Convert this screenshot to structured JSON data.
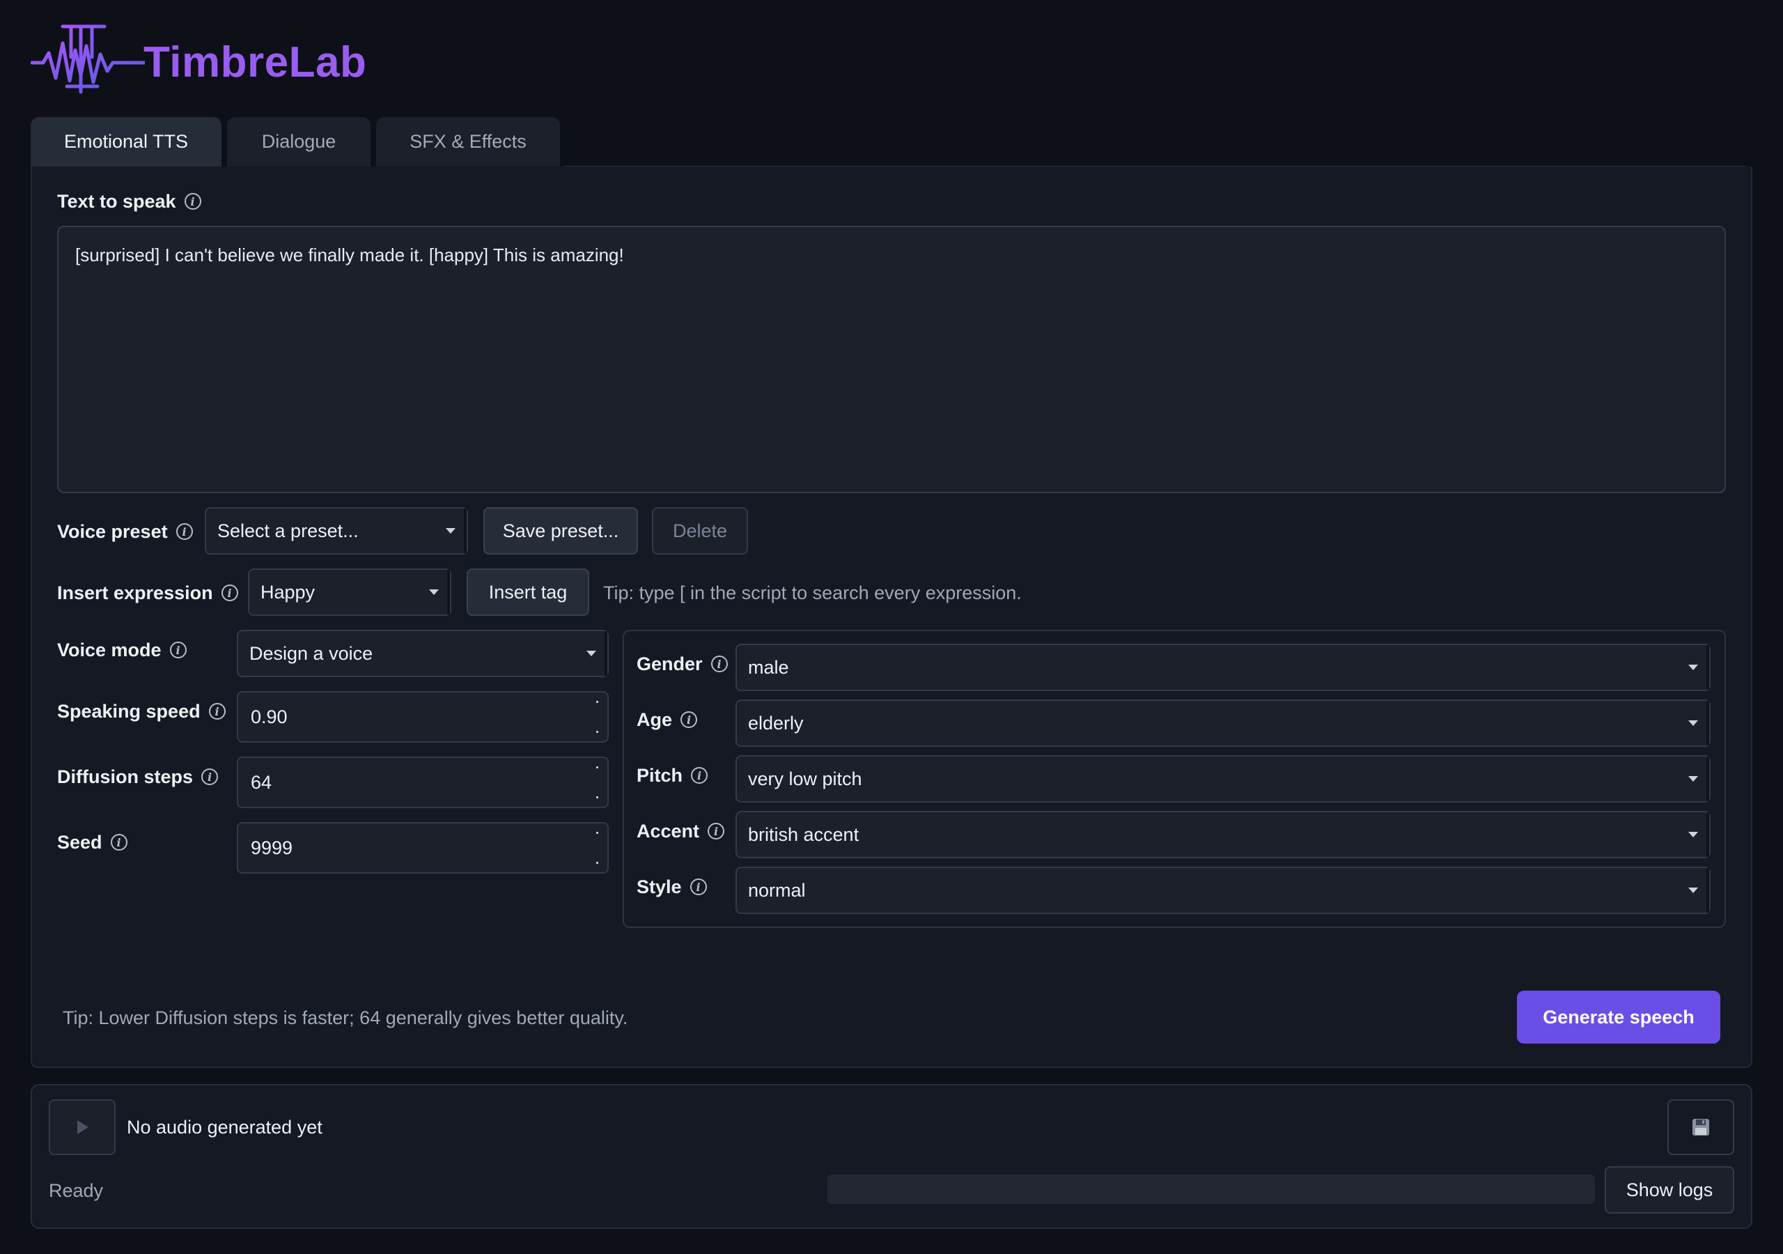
{
  "app": {
    "name": "TimbreLab"
  },
  "tabs": [
    {
      "label": "Emotional TTS",
      "active": true
    },
    {
      "label": "Dialogue",
      "active": false
    },
    {
      "label": "SFX & Effects",
      "active": false
    }
  ],
  "script": {
    "label": "Text to speak",
    "value": "[surprised] I can't believe we finally made it. [happy] This is amazing!"
  },
  "preset": {
    "label": "Voice preset",
    "selected": "Select a preset...",
    "save_label": "Save preset...",
    "delete_label": "Delete"
  },
  "expression": {
    "label": "Insert expression",
    "selected": "Happy",
    "insert_label": "Insert tag",
    "tip": "Tip: type [ in the script to search every expression."
  },
  "voice_mode": {
    "label": "Voice mode",
    "selected": "Design a voice"
  },
  "speed": {
    "label": "Speaking speed",
    "value": "0.90"
  },
  "steps": {
    "label": "Diffusion steps",
    "value": "64"
  },
  "seed": {
    "label": "Seed",
    "value": "9999"
  },
  "design": {
    "gender": {
      "label": "Gender",
      "selected": "male"
    },
    "age": {
      "label": "Age",
      "selected": "elderly"
    },
    "pitch": {
      "label": "Pitch",
      "selected": "very low pitch"
    },
    "accent": {
      "label": "Accent",
      "selected": "british accent"
    },
    "style": {
      "label": "Style",
      "selected": "normal"
    }
  },
  "footer": {
    "tip": "Tip: Lower Diffusion steps is faster; 64 generally gives better quality.",
    "generate_label": "Generate speech"
  },
  "player": {
    "empty_text": "No audio generated yet",
    "status": "Ready",
    "progress": 0,
    "logs_label": "Show logs"
  },
  "colors": {
    "accent": "#6a4ee6",
    "logo": "#9b5cf0",
    "background": "#0d1117",
    "panel": "#151923"
  }
}
